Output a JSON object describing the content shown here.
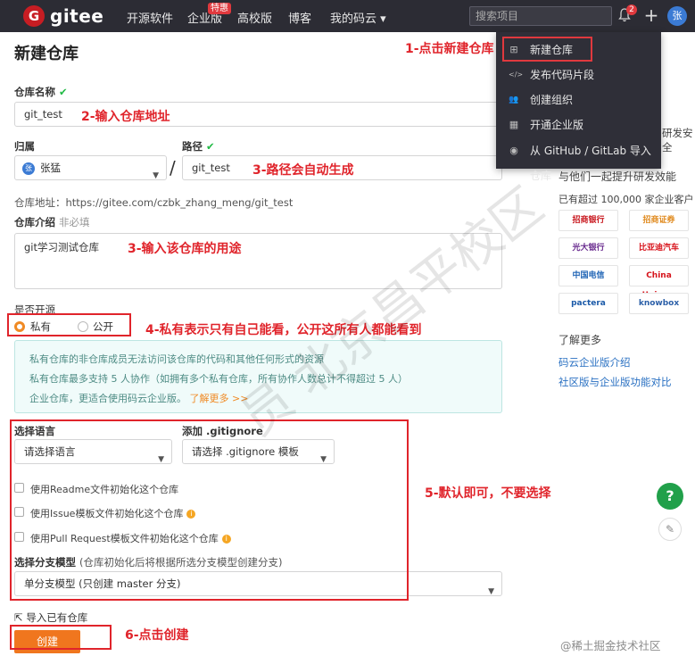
{
  "nav": {
    "logo_letter": "G",
    "logo_text": "gitee",
    "items": [
      "开源软件",
      "企业版",
      "高校版",
      "博客",
      "我的码云 ▾"
    ],
    "enterprise_badge": "特惠",
    "search_placeholder": "搜索项目",
    "notification_count": "2",
    "plus": "+",
    "avatar": "张"
  },
  "dropdown": {
    "items": [
      {
        "icon": "plus-square-icon",
        "glyph": "⊞",
        "label": "新建仓库"
      },
      {
        "icon": "code-icon",
        "glyph": "</>",
        "label": "发布代码片段"
      },
      {
        "icon": "team-icon",
        "glyph": "👥",
        "label": "创建组织"
      },
      {
        "icon": "building-icon",
        "glyph": "▦",
        "label": "开通企业版"
      },
      {
        "icon": "github-icon",
        "glyph": "◉",
        "label": "从 GitHub / GitLab 导入仓库"
      }
    ]
  },
  "form": {
    "title": "新建仓库",
    "repo_name_label": "仓库名称",
    "repo_name_value": "git_test",
    "owner_label": "归属",
    "owner_avatar": "张",
    "owner_value": "张猛",
    "path_label": "路径",
    "path_value": "git_test",
    "repo_address": "仓库地址：https://gitee.com/czbk_zhang_meng/git_test",
    "intro_label": "仓库介绍",
    "intro_optional": "非必填",
    "intro_value": "git学习测试仓库",
    "open_source_label": "是否开源",
    "private_label": "私有",
    "public_label": "公开",
    "info_lines": [
      "私有仓库的非仓库成员无法访问该仓库的代码和其他任何形式的资源",
      "私有仓库最多支持 5 人协作（如拥有多个私有仓库，所有协作人数总计不得超过 5 人）",
      "企业仓库，更适合使用码云企业版。"
    ],
    "info_link": "了解更多 >>",
    "language_label": "选择语言",
    "language_value": "请选择语言",
    "gitignore_label": "添加 .gitignore",
    "gitignore_value": "请选择 .gitignore 模板",
    "checkbox_readme": "使用Readme文件初始化这个仓库",
    "checkbox_issue": "使用Issue模板文件初始化这个仓库",
    "checkbox_pr": "使用Pull Request模板文件初始化这个仓库",
    "branch_label": "选择分支模型",
    "branch_hint": "(仓库初始化后将根据所选分支模型创建分支)",
    "branch_value": "单分支模型 (只创建 master 分支)",
    "import_link": "导入已有仓库",
    "create_button": "创建"
  },
  "annotations": {
    "a1": "1-点击新建仓库",
    "a2": "2-输入仓库地址",
    "a3a": "3-路径会自动生成",
    "a3b": "3-输入该仓库的用途",
    "a4": "4-私有表示只有自己能看，公开这所有人都能看到",
    "a5": "5-默认即可，不要选择",
    "a6": "6-点击创建"
  },
  "sidebar": {
    "partial": "研发安全",
    "tagline": "与他们一起提升研发效能",
    "customers": "已有超过 100,000 家企业客户",
    "brands": [
      "招商银行",
      "招商证券",
      "光大银行",
      "比亚迪汽车",
      "中国电信",
      "China Unicom",
      "pactera",
      "knowbox"
    ],
    "learn_more": "了解更多",
    "links": [
      "码云企业版介绍",
      "社区版与企业版功能对比"
    ]
  },
  "watermark": "员 北京昌平校区",
  "credit": "@稀土掘金技术社区",
  "colors": {
    "accent_red": "#e0242b",
    "orange": "#f0761e",
    "nav_bg": "#2c2c34",
    "green": "#21a04a"
  }
}
